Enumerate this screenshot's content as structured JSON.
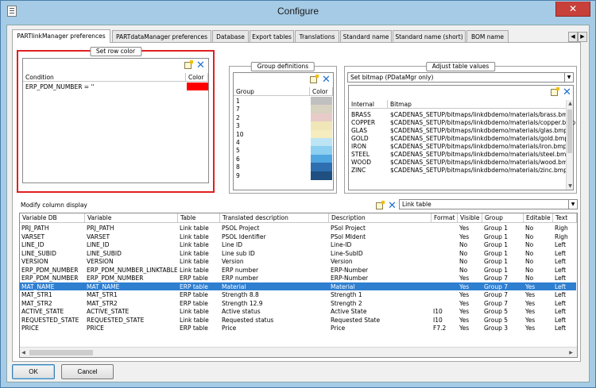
{
  "window": {
    "title": "Configure",
    "close_glyph": "✕"
  },
  "tabs": [
    "PARTlinkManager preferences",
    "PARTdataManager preferences",
    "Database",
    "Export tables",
    "Translations",
    "Standard name",
    "Standard name (short)",
    "BOM name"
  ],
  "row_color": {
    "title": "Set row color",
    "headers": [
      "Condition",
      "Color"
    ],
    "rows": [
      {
        "condition": "ERP_PDM_NUMBER = ''",
        "color": "#ff0000"
      }
    ]
  },
  "group_definitions": {
    "title": "Group definitions",
    "headers": [
      "Group",
      "Color"
    ],
    "rows": [
      {
        "group": "1",
        "color": "#c0c0c0"
      },
      {
        "group": "7",
        "color": "#d8d2c0"
      },
      {
        "group": "2",
        "color": "#e8cbc8"
      },
      {
        "group": "3",
        "color": "#f0e6b8"
      },
      {
        "group": "10",
        "color": "#f5ecc0"
      },
      {
        "group": "4",
        "color": "#bde4f4"
      },
      {
        "group": "5",
        "color": "#8ccff0"
      },
      {
        "group": "6",
        "color": "#4fa6e0"
      },
      {
        "group": "8",
        "color": "#2d6fb0"
      },
      {
        "group": "9",
        "color": "#1f4f80"
      }
    ]
  },
  "table_values": {
    "title": "Adjust table values",
    "selector": "Set bitmap (PDataMgr only)",
    "headers": [
      "Internal",
      "Bitmap"
    ],
    "rows": [
      {
        "internal": "BRASS",
        "bitmap": "$CADENAS_SETUP/bitmaps/linkdbdemo/materials/brass.bmp"
      },
      {
        "internal": "COPPER",
        "bitmap": "$CADENAS_SETUP/bitmaps/linkdbdemo/materials/copper.bmp"
      },
      {
        "internal": "GLAS",
        "bitmap": "$CADENAS_SETUP/bitmaps/linkdbdemo/materials/glas.bmp"
      },
      {
        "internal": "GOLD",
        "bitmap": "$CADENAS_SETUP/bitmaps/linkdbdemo/materials/gold.bmp"
      },
      {
        "internal": "IRON",
        "bitmap": "$CADENAS_SETUP/bitmaps/linkdbdemo/materials/iron.bmp"
      },
      {
        "internal": "STEEL",
        "bitmap": "$CADENAS_SETUP/bitmaps/linkdbdemo/materials/steel.bmp"
      },
      {
        "internal": "WOOD",
        "bitmap": "$CADENAS_SETUP/bitmaps/linkdbdemo/materials/wood.bmp"
      },
      {
        "internal": "ZINC",
        "bitmap": "$CADENAS_SETUP/bitmaps/linkdbdemo/materials/zinc.bmp"
      }
    ]
  },
  "column_display": {
    "title": "Modify column display",
    "selector": "Link table",
    "headers": [
      "Variable DB",
      "Variable",
      "Table",
      "Translated description",
      "Description",
      "Format",
      "Visible",
      "Group",
      "Editable",
      "Text"
    ],
    "rows": [
      [
        "PRJ_PATH",
        "PRJ_PATH",
        "Link table",
        "PSOL Project",
        "PSol Project",
        "",
        "Yes",
        "Group 1",
        "No",
        "Righ"
      ],
      [
        "VARSET",
        "VARSET",
        "Link table",
        "PSOL Identifier",
        "PSol MIdent",
        "",
        "Yes",
        "Group 1",
        "No",
        "Righ"
      ],
      [
        "LINE_ID",
        "LINE_ID",
        "Link table",
        "Line ID",
        "Line-ID",
        "",
        "No",
        "Group 1",
        "No",
        "Left"
      ],
      [
        "LINE_SUBID",
        "LINE_SUBID",
        "Link table",
        "Line sub ID",
        "Line-SubID",
        "",
        "No",
        "Group 1",
        "No",
        "Left"
      ],
      [
        "VERSION",
        "VERSION",
        "Link table",
        "Version",
        "Version",
        "",
        "No",
        "Group 1",
        "No",
        "Left"
      ],
      [
        "ERP_PDM_NUMBER",
        "ERP_PDM_NUMBER_LINKTABLE",
        "Link table",
        "ERP number",
        "ERP-Number",
        "",
        "No",
        "Group 1",
        "No",
        "Left"
      ],
      [
        "ERP_PDM_NUMBER",
        "ERP_PDM_NUMBER",
        "ERP table",
        "ERP number",
        "ERP-Number",
        "",
        "Yes",
        "Group 7",
        "No",
        "Left"
      ],
      [
        "MAT_NAME",
        "MAT_NAME",
        "ERP table",
        "Material",
        "Material",
        "",
        "Yes",
        "Group 7",
        "Yes",
        "Left"
      ],
      [
        "MAT_STR1",
        "MAT_STR1",
        "ERP table",
        "Strength 8.8",
        "Strength 1",
        "",
        "Yes",
        "Group 7",
        "Yes",
        "Left"
      ],
      [
        "MAT_STR2",
        "MAT_STR2",
        "ERP table",
        "Strength 12.9",
        "Strength 2",
        "",
        "Yes",
        "Group 7",
        "Yes",
        "Left"
      ],
      [
        "ACTIVE_STATE",
        "ACTIVE_STATE",
        "Link table",
        "Active status",
        "Active State",
        "I10",
        "Yes",
        "Group 5",
        "Yes",
        "Left"
      ],
      [
        "REQUESTED_STATE",
        "REQUESTED_STATE",
        "Link table",
        "Requested status",
        "Requested State",
        "I10",
        "Yes",
        "Group 5",
        "Yes",
        "Left"
      ],
      [
        "PRICE",
        "PRICE",
        "ERP table",
        "Price",
        "Price",
        "F7.2",
        "Yes",
        "Group 3",
        "Yes",
        "Left"
      ]
    ]
  },
  "buttons": {
    "ok": "OK",
    "cancel": "Cancel"
  }
}
